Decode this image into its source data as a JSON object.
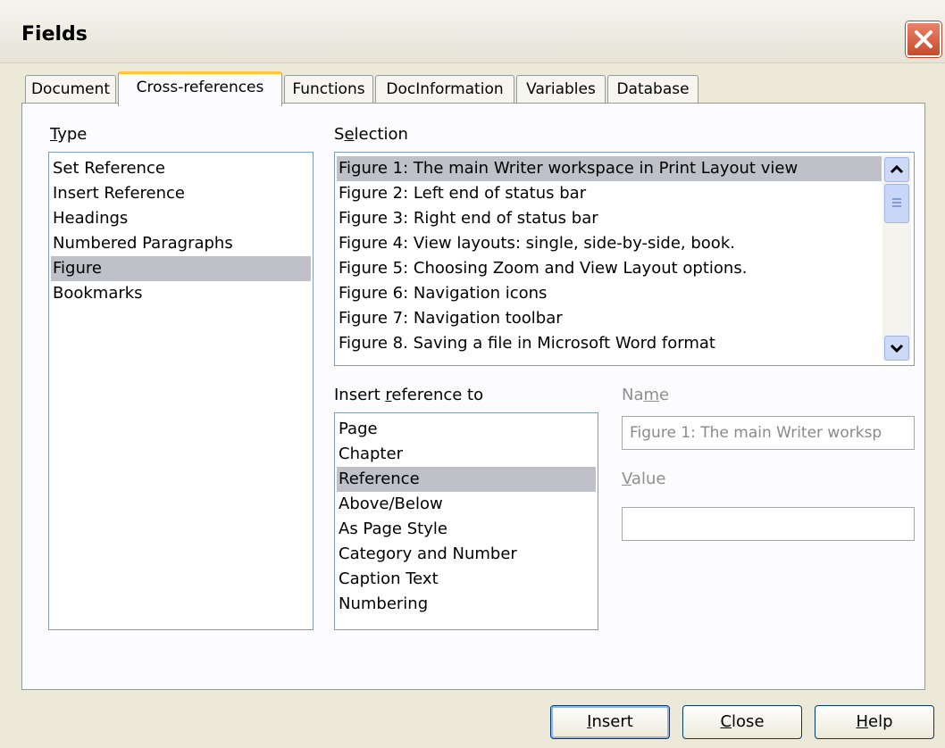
{
  "window": {
    "title": "Fields"
  },
  "tabs": [
    {
      "label": "Document",
      "active": false
    },
    {
      "label": "Cross-references",
      "active": true
    },
    {
      "label": "Functions",
      "active": false
    },
    {
      "label": "DocInformation",
      "active": false
    },
    {
      "label": "Variables",
      "active": false
    },
    {
      "label": "Database",
      "active": false
    }
  ],
  "type": {
    "label": "Type",
    "items": [
      "Set Reference",
      "Insert Reference",
      "Headings",
      "Numbered Paragraphs",
      "Figure",
      "Bookmarks"
    ],
    "selected": "Figure"
  },
  "selection": {
    "label": "Selection",
    "items": [
      "Figure 1: The main Writer workspace in Print Layout view",
      "Figure 2: Left end of status bar",
      "Figure 3: Right end of status bar",
      "Figure 4: View layouts: single, side-by-side, book.",
      "Figure 5: Choosing Zoom and View Layout options.",
      "Figure 6: Navigation icons",
      "Figure 7: Navigation toolbar",
      "Figure 8. Saving a file in Microsoft Word format"
    ],
    "selected": "Figure 1: The main Writer workspace in Print Layout view"
  },
  "insert_reference": {
    "label": "Insert reference to",
    "items": [
      "Page",
      "Chapter",
      "Reference",
      "Above/Below",
      "As Page Style",
      "Category and Number",
      "Caption Text",
      "Numbering"
    ],
    "selected": "Reference"
  },
  "name": {
    "label": "Name",
    "value": "Figure 1: The main Writer worksp"
  },
  "value": {
    "label": "Value",
    "value": ""
  },
  "buttons": {
    "insert": "Insert",
    "close": "Close",
    "help": "Help"
  },
  "colors": {
    "dialog_bg": "#ece9d8",
    "selection_bg": "#c0c0c8",
    "active_tab_accent": "#ffc83c",
    "close_button": "#c64b2c"
  },
  "icons": [
    "close-icon",
    "scroll-up-icon",
    "scroll-grip-icon",
    "scroll-down-icon"
  ]
}
